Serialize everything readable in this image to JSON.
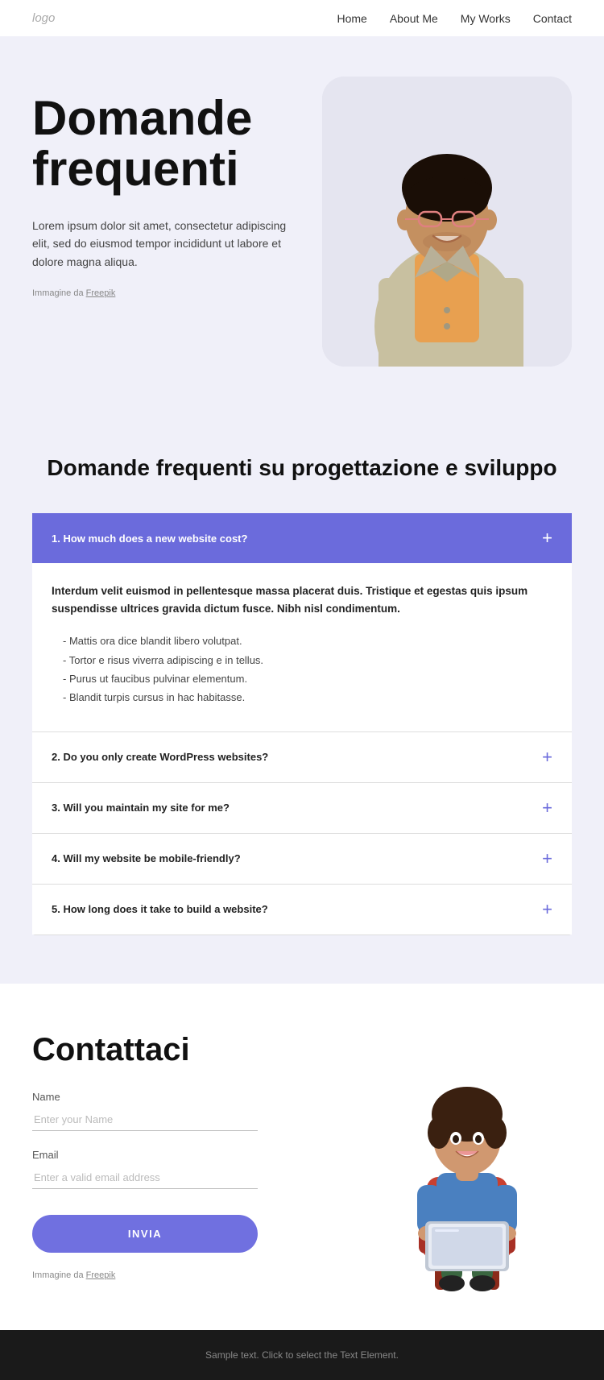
{
  "nav": {
    "logo": "logo",
    "links": [
      {
        "label": "Home",
        "href": "#"
      },
      {
        "label": "About Me",
        "href": "#"
      },
      {
        "label": "My Works",
        "href": "#"
      },
      {
        "label": "Contact",
        "href": "#"
      }
    ]
  },
  "hero": {
    "title_line1": "Domande",
    "title_line2": "frequenti",
    "description": "Lorem ipsum dolor sit amet, consectetur adipiscing elit, sed do eiusmod tempor incididunt ut labore et dolore magna aliqua.",
    "immagine_label": "Immagine da",
    "immagine_link_text": "Freepik"
  },
  "faq": {
    "section_title": "Domande frequenti su progettazione e sviluppo",
    "items": [
      {
        "id": 1,
        "question": "1. How much does a new website cost?",
        "open": true,
        "bold_text": "Interdum velit euismod in pellentesque massa placerat duis. Tristique et egestas quis ipsum suspendisse ultrices gravida dictum fusce. Nibh nisl condimentum.",
        "bullets": [
          "Mattis ora dice blandit libero volutpat.",
          "Tortor e risus viverra adipiscing e in tellus.",
          "Purus ut faucibus pulvinar elementum.",
          "Blandit turpis cursus in hac habitasse."
        ]
      },
      {
        "id": 2,
        "question": "2. Do you only create WordPress websites?",
        "open": false,
        "bold_text": "",
        "bullets": []
      },
      {
        "id": 3,
        "question": "3. Will you maintain my site for me?",
        "open": false,
        "bold_text": "",
        "bullets": []
      },
      {
        "id": 4,
        "question": "4. Will my website be mobile-friendly?",
        "open": false,
        "bold_text": "",
        "bullets": []
      },
      {
        "id": 5,
        "question": "5. How long does it take to build a website?",
        "open": false,
        "bold_text": "",
        "bullets": []
      }
    ]
  },
  "contact": {
    "title": "Contattaci",
    "name_label": "Name",
    "name_placeholder": "Enter your Name",
    "email_label": "Email",
    "email_placeholder": "Enter a valid email address",
    "submit_label": "INVIA",
    "immagine_label": "Immagine da",
    "immagine_link_text": "Freepik"
  },
  "footer": {
    "text": "Sample text. Click to select the Text Element."
  }
}
